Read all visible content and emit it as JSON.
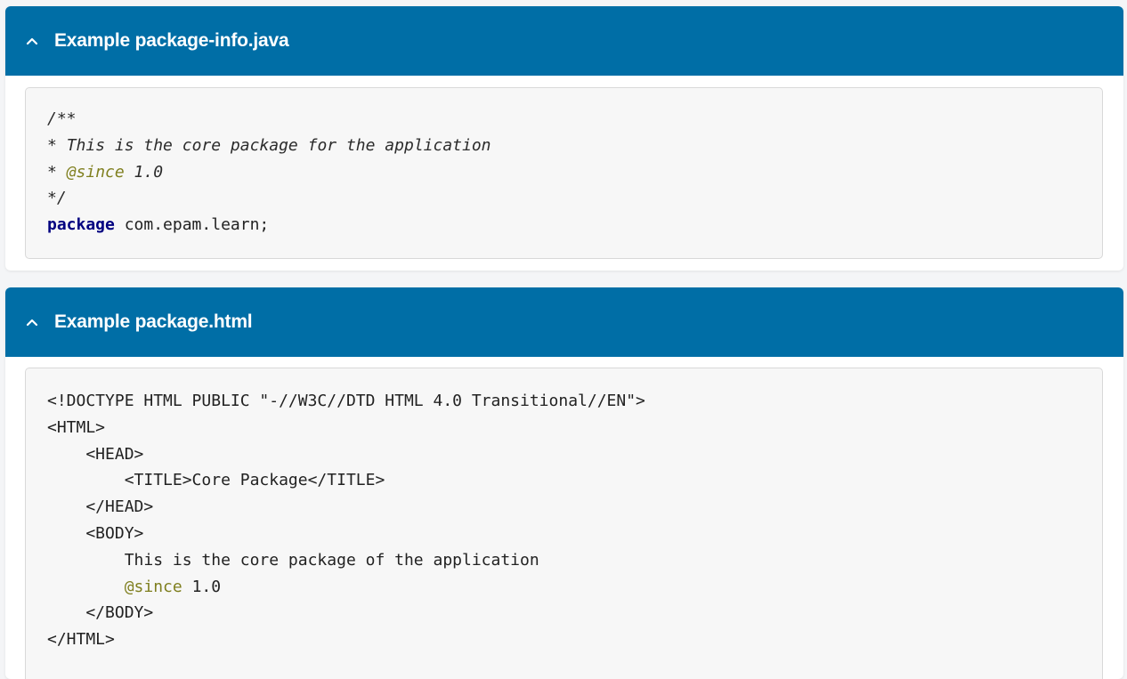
{
  "panels": [
    {
      "title": "Example package-info.java",
      "expanded": true,
      "code": {
        "comment_open": "/**",
        "desc_prefix": "* ",
        "desc_text": "This is the core package for the application",
        "since_prefix": "* ",
        "since_tag": "@since",
        "since_value": " 1.0",
        "comment_close": "*/",
        "keyword": "package",
        "package_name": " com.epam.learn;"
      }
    },
    {
      "title": "Example package.html",
      "expanded": true,
      "lines": {
        "doctype": "<!DOCTYPE HTML PUBLIC \"-//W3C//DTD HTML 4.0 Transitional//EN\">",
        "html_open": "<HTML>",
        "head_open": "    <HEAD>",
        "title_line": "        <TITLE>Core Package</TITLE>",
        "head_close": "    </HEAD>",
        "body_open": "    <BODY>",
        "body_text": "        This is the core package of the application",
        "since_indent": "        ",
        "since_tag": "@since",
        "since_value": " 1.0",
        "body_close": "    </BODY>",
        "html_close": "</HTML>"
      }
    }
  ],
  "colors": {
    "header_bg": "#006ea6",
    "header_text": "#ffffff",
    "code_bg": "#f7f7f7",
    "javadoc_tag": "#7f7f1f",
    "keyword": "#000080"
  },
  "icons": {
    "collapse": "chevron-up-icon"
  }
}
